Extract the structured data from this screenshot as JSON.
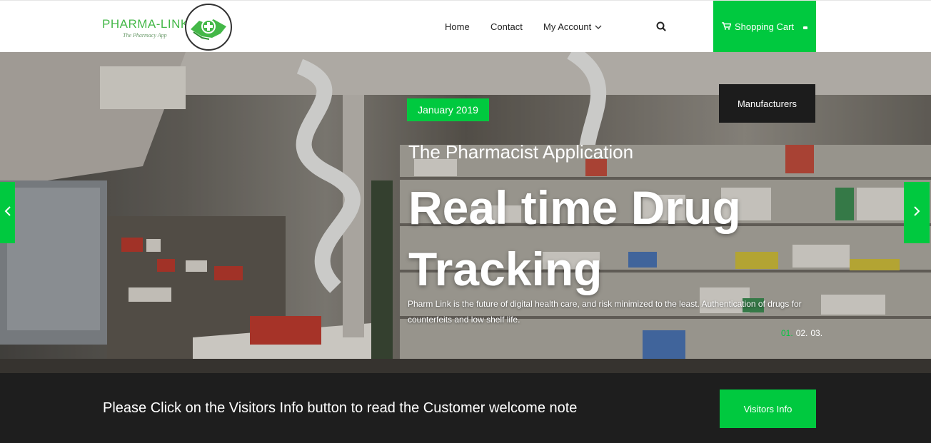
{
  "logo": {
    "name": "PHARMA-LINK",
    "tagline": "The Pharmacy App"
  },
  "nav": {
    "home": "Home",
    "contact": "Contact",
    "account": "My Account",
    "cart": "Shopping Cart"
  },
  "hero": {
    "date_badge": "January 2019",
    "manufacturers": "Manufacturers",
    "subtitle": "The Pharmacist Application",
    "headline": "Real time Drug Tracking",
    "description": "Pharm Link is the future of digital health care, and risk minimized to the least. Authentication of drugs for counterfeits and low shelf life.",
    "slides": [
      "01.",
      "02.",
      "03."
    ],
    "active_slide": 0
  },
  "footer_bar": {
    "message": "Please Click on the Visitors Info button to read the Customer welcome note",
    "button": "Visitors Info"
  },
  "colors": {
    "accent": "#00c93f",
    "dark": "#1e1e1e",
    "logo_green": "#44b848"
  },
  "icons": [
    "handshake-cross-icon",
    "chevron-down-icon",
    "search-icon",
    "cart-icon",
    "arrow-left-icon",
    "arrow-right-icon"
  ]
}
